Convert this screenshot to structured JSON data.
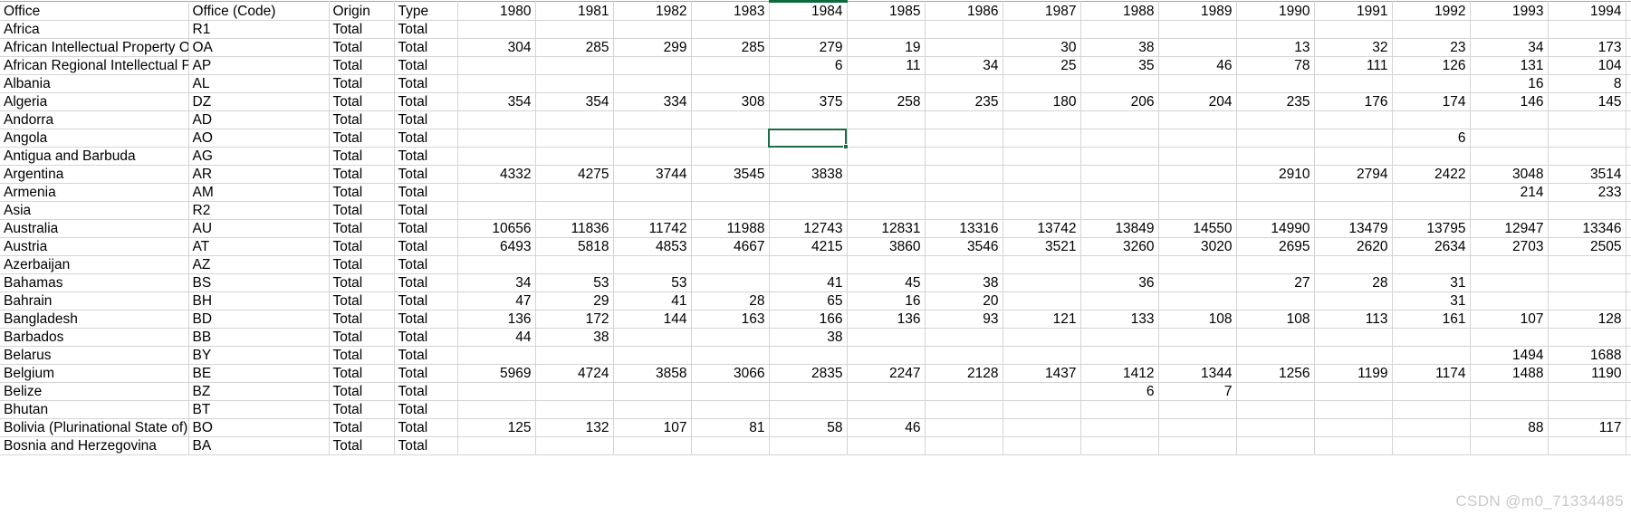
{
  "app": {
    "kind": "spreadsheet-grid",
    "accent_color": "#1b6b45",
    "gridline_color": "#d4d4d4"
  },
  "watermark": {
    "text": "CSDN @m0_71334485"
  },
  "selection": {
    "active_cell_row_label": "Angola",
    "active_cell_column_label": "1984",
    "selected_column_label": "1984",
    "border_color": "#1b6b45"
  },
  "columns": {
    "fixed": [
      "Office",
      "Office (Code)",
      "Origin",
      "Type"
    ],
    "years": [
      "1980",
      "1981",
      "1982",
      "1983",
      "1984",
      "1985",
      "1986",
      "1987",
      "1988",
      "1989",
      "1990",
      "1991",
      "1992",
      "1993",
      "1994"
    ]
  },
  "rows": [
    {
      "office": "Africa",
      "code": "R1",
      "origin": "Total",
      "type": "Total",
      "values": [
        "",
        "",
        "",
        "",
        "",
        "",
        "",
        "",
        "",
        "",
        "",
        "",
        "",
        "",
        ""
      ]
    },
    {
      "office": "African Intellectual Property O",
      "code": "OA",
      "origin": "Total",
      "type": "Total",
      "values": [
        "304",
        "285",
        "299",
        "285",
        "279",
        "19",
        "",
        "30",
        "38",
        "",
        "13",
        "32",
        "23",
        "34",
        "173"
      ]
    },
    {
      "office": "African Regional Intellectual Pr",
      "code": "AP",
      "origin": "Total",
      "type": "Total",
      "values": [
        "",
        "",
        "",
        "",
        "6",
        "11",
        "34",
        "25",
        "35",
        "46",
        "78",
        "111",
        "126",
        "131",
        "104"
      ]
    },
    {
      "office": "Albania",
      "code": "AL",
      "origin": "Total",
      "type": "Total",
      "values": [
        "",
        "",
        "",
        "",
        "",
        "",
        "",
        "",
        "",
        "",
        "",
        "",
        "",
        "16",
        "8"
      ]
    },
    {
      "office": "Algeria",
      "code": "DZ",
      "origin": "Total",
      "type": "Total",
      "values": [
        "354",
        "354",
        "334",
        "308",
        "375",
        "258",
        "235",
        "180",
        "206",
        "204",
        "235",
        "176",
        "174",
        "146",
        "145"
      ]
    },
    {
      "office": "Andorra",
      "code": "AD",
      "origin": "Total",
      "type": "Total",
      "values": [
        "",
        "",
        "",
        "",
        "",
        "",
        "",
        "",
        "",
        "",
        "",
        "",
        "",
        "",
        ""
      ]
    },
    {
      "office": "Angola",
      "code": "AO",
      "origin": "Total",
      "type": "Total",
      "values": [
        "",
        "",
        "",
        "",
        "",
        "",
        "",
        "",
        "",
        "",
        "",
        "",
        "6",
        "",
        ""
      ]
    },
    {
      "office": "Antigua and Barbuda",
      "code": "AG",
      "origin": "Total",
      "type": "Total",
      "values": [
        "",
        "",
        "",
        "",
        "",
        "",
        "",
        "",
        "",
        "",
        "",
        "",
        "",
        "",
        ""
      ]
    },
    {
      "office": "Argentina",
      "code": "AR",
      "origin": "Total",
      "type": "Total",
      "values": [
        "4332",
        "4275",
        "3744",
        "3545",
        "3838",
        "",
        "",
        "",
        "",
        "",
        "2910",
        "2794",
        "2422",
        "3048",
        "3514"
      ]
    },
    {
      "office": "Armenia",
      "code": "AM",
      "origin": "Total",
      "type": "Total",
      "values": [
        "",
        "",
        "",
        "",
        "",
        "",
        "",
        "",
        "",
        "",
        "",
        "",
        "",
        "214",
        "233"
      ]
    },
    {
      "office": "Asia",
      "code": "R2",
      "origin": "Total",
      "type": "Total",
      "values": [
        "",
        "",
        "",
        "",
        "",
        "",
        "",
        "",
        "",
        "",
        "",
        "",
        "",
        "",
        ""
      ]
    },
    {
      "office": "Australia",
      "code": "AU",
      "origin": "Total",
      "type": "Total",
      "values": [
        "10656",
        "11836",
        "11742",
        "11988",
        "12743",
        "12831",
        "13316",
        "13742",
        "13849",
        "14550",
        "14990",
        "13479",
        "13795",
        "12947",
        "13346"
      ]
    },
    {
      "office": "Austria",
      "code": "AT",
      "origin": "Total",
      "type": "Total",
      "values": [
        "6493",
        "5818",
        "4853",
        "4667",
        "4215",
        "3860",
        "3546",
        "3521",
        "3260",
        "3020",
        "2695",
        "2620",
        "2634",
        "2703",
        "2505"
      ]
    },
    {
      "office": "Azerbaijan",
      "code": "AZ",
      "origin": "Total",
      "type": "Total",
      "values": [
        "",
        "",
        "",
        "",
        "",
        "",
        "",
        "",
        "",
        "",
        "",
        "",
        "",
        "",
        ""
      ]
    },
    {
      "office": "Bahamas",
      "code": "BS",
      "origin": "Total",
      "type": "Total",
      "values": [
        "34",
        "53",
        "53",
        "",
        "41",
        "45",
        "38",
        "",
        "36",
        "",
        "27",
        "28",
        "31",
        "",
        ""
      ]
    },
    {
      "office": "Bahrain",
      "code": "BH",
      "origin": "Total",
      "type": "Total",
      "values": [
        "47",
        "29",
        "41",
        "28",
        "65",
        "16",
        "20",
        "",
        "",
        "",
        "",
        "",
        "31",
        "",
        ""
      ]
    },
    {
      "office": "Bangladesh",
      "code": "BD",
      "origin": "Total",
      "type": "Total",
      "values": [
        "136",
        "172",
        "144",
        "163",
        "166",
        "136",
        "93",
        "121",
        "133",
        "108",
        "108",
        "113",
        "161",
        "107",
        "128"
      ]
    },
    {
      "office": "Barbados",
      "code": "BB",
      "origin": "Total",
      "type": "Total",
      "values": [
        "44",
        "38",
        "",
        "",
        "38",
        "",
        "",
        "",
        "",
        "",
        "",
        "",
        "",
        "",
        ""
      ]
    },
    {
      "office": "Belarus",
      "code": "BY",
      "origin": "Total",
      "type": "Total",
      "values": [
        "",
        "",
        "",
        "",
        "",
        "",
        "",
        "",
        "",
        "",
        "",
        "",
        "",
        "1494",
        "1688"
      ]
    },
    {
      "office": "Belgium",
      "code": "BE",
      "origin": "Total",
      "type": "Total",
      "values": [
        "5969",
        "4724",
        "3858",
        "3066",
        "2835",
        "2247",
        "2128",
        "1437",
        "1412",
        "1344",
        "1256",
        "1199",
        "1174",
        "1488",
        "1190"
      ]
    },
    {
      "office": "Belize",
      "code": "BZ",
      "origin": "Total",
      "type": "Total",
      "values": [
        "",
        "",
        "",
        "",
        "",
        "",
        "",
        "",
        "6",
        "7",
        "",
        "",
        "",
        "",
        ""
      ]
    },
    {
      "office": "Bhutan",
      "code": "BT",
      "origin": "Total",
      "type": "Total",
      "values": [
        "",
        "",
        "",
        "",
        "",
        "",
        "",
        "",
        "",
        "",
        "",
        "",
        "",
        "",
        ""
      ]
    },
    {
      "office": "Bolivia (Plurinational State of)",
      "code": "BO",
      "origin": "Total",
      "type": "Total",
      "values": [
        "125",
        "132",
        "107",
        "81",
        "58",
        "46",
        "",
        "",
        "",
        "",
        "",
        "",
        "",
        "88",
        "117"
      ]
    },
    {
      "office": "Bosnia and Herzegovina",
      "code": "BA",
      "origin": "Total",
      "type": "Total",
      "values": [
        "",
        "",
        "",
        "",
        "",
        "",
        "",
        "",
        "",
        "",
        "",
        "",
        "",
        "",
        ""
      ]
    }
  ]
}
